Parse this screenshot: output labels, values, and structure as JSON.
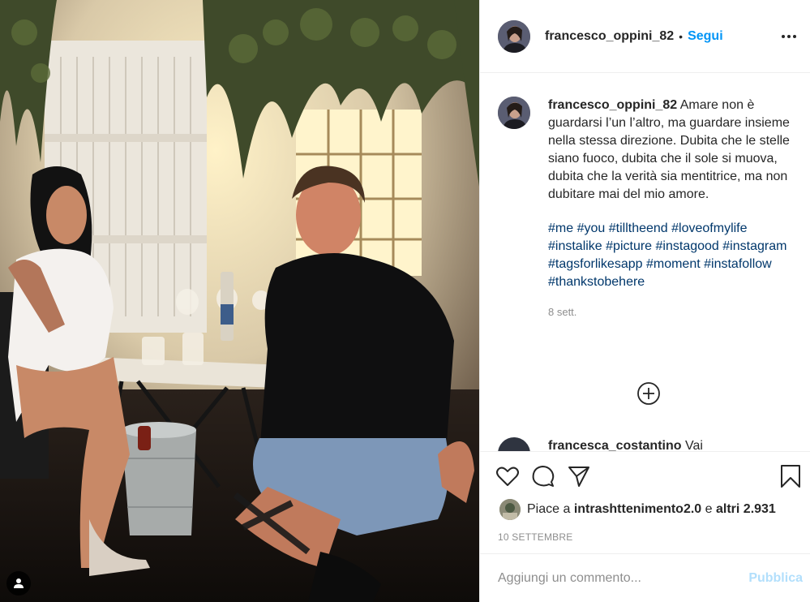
{
  "post": {
    "username": "francesco_oppini_82",
    "dot": "•",
    "follow_label": "Segui",
    "more_icon": "more-horizontal-icon"
  },
  "caption": {
    "username": "francesco_oppini_82",
    "text": "Amare non è guardarsi l’un l’altro, ma guardare insieme nella stessa direzione. Dubita che le stelle siano fuoco, dubita che il sole si muova, dubita che la verità sia mentitrice, ma non dubitare mai del mio amore.",
    "hashtags": [
      "#me",
      "#you",
      "#tilltheend",
      "#loveofmylife",
      "#instalike",
      "#picture",
      "#instagood",
      "#instagram",
      "#tagsforlikesapp",
      "#moment",
      "#instafollow",
      "#thankstobehere"
    ],
    "time": "8 sett."
  },
  "next_comment": {
    "username": "francesca_costantino",
    "text": "Vai"
  },
  "actions": {
    "like_icon": "heart-icon",
    "comment_icon": "comment-icon",
    "share_icon": "share-icon",
    "save_icon": "bookmark-icon"
  },
  "likes": {
    "prefix": "Piace a",
    "user": "intrashttenimento2.0",
    "middle": "e",
    "others": "altri 2.931"
  },
  "date": "10 SETTEMBRE",
  "comment_box": {
    "placeholder": "Aggiungi un commento...",
    "publish_label": "Pubblica"
  },
  "colors": {
    "accent": "#0095f6",
    "hashtag": "#00376b",
    "muted": "#8e8e8e",
    "publish_disabled": "#b2dffc"
  }
}
